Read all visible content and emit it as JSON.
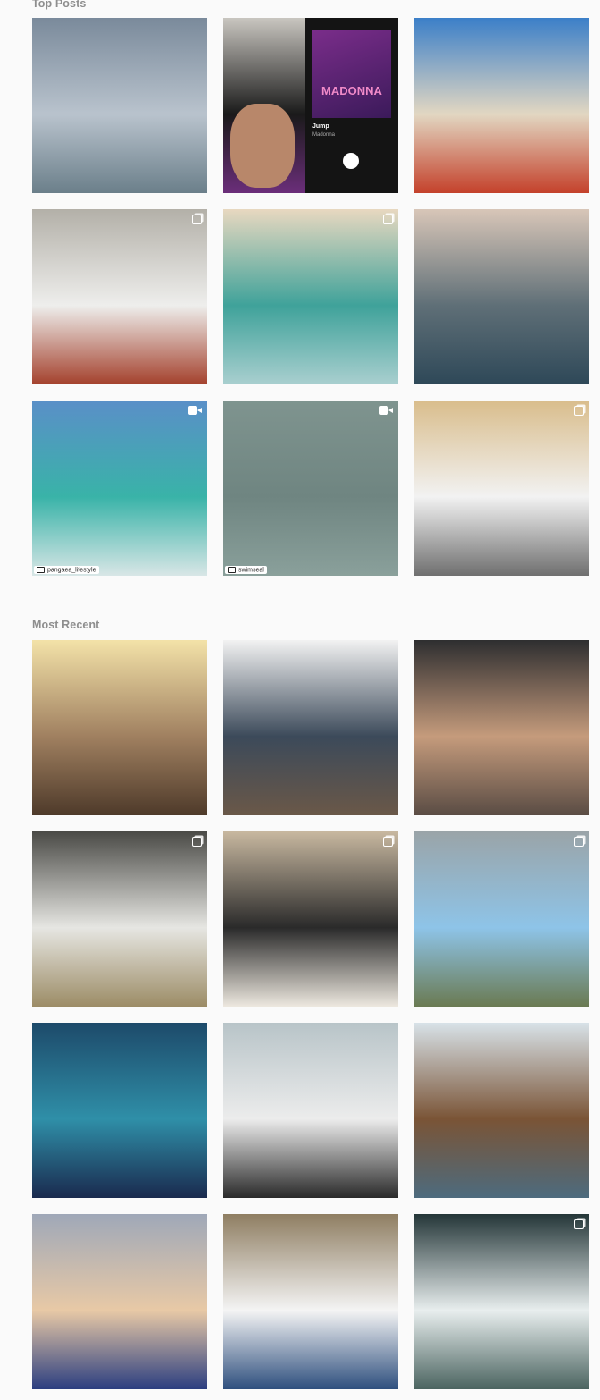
{
  "top_posts": {
    "title": "Top Posts",
    "posts": [
      {
        "name": "post-surfer-small-wave",
        "badge": "none",
        "colors": [
          "#7a8a9b",
          "#b9c3cd",
          "#6b7f8a"
        ]
      },
      {
        "name": "post-selfie-spotify-madonna",
        "badge": "none",
        "colors": [
          "#c9c6c0",
          "#1a1a1a",
          "#6b2e7a"
        ],
        "spotify": {
          "song": "Jump",
          "artist": "Madonna",
          "tag": "MADONNA"
        }
      },
      {
        "name": "post-red-surfboard-beach",
        "badge": "none",
        "colors": [
          "#3b7fc8",
          "#e2d7c2",
          "#c4412b"
        ]
      },
      {
        "name": "post-man-holding-fish-board",
        "badge": "multi",
        "colors": [
          "#b3b0a8",
          "#eeeeec",
          "#a4412d"
        ]
      },
      {
        "name": "post-green-barrel-wave",
        "badge": "video-small",
        "colors": [
          "#e8d8c0",
          "#3fa29a",
          "#a9cfcf"
        ]
      },
      {
        "name": "post-sunset-wave",
        "badge": "none",
        "colors": [
          "#d8c6b8",
          "#5f6f77",
          "#2e4858"
        ]
      },
      {
        "name": "post-turquoise-wave-ride",
        "badge": "video",
        "colors": [
          "#5a8fc8",
          "#39b3a8",
          "#d8e6e6"
        ],
        "repost": "pangaea_lifestyle"
      },
      {
        "name": "post-grey-ocean",
        "badge": "video",
        "colors": [
          "#7f948f",
          "#6f8581",
          "#8aa09b"
        ],
        "repost": "swimseal"
      },
      {
        "name": "post-man-white-surfboard",
        "badge": "multi",
        "colors": [
          "#d9bd8c",
          "#f2f2f2",
          "#6f6f6f"
        ]
      }
    ]
  },
  "most_recent": {
    "title": "Most Recent",
    "posts": [
      {
        "name": "post-golden-sunset-beach",
        "badge": "none",
        "colors": [
          "#f3e2a8",
          "#a08060",
          "#4e3a2a"
        ]
      },
      {
        "name": "post-rocks-coast",
        "badge": "none",
        "colors": [
          "#f2f2f2",
          "#3c4a5a",
          "#6a5848"
        ]
      },
      {
        "name": "post-surprised-face",
        "badge": "none",
        "colors": [
          "#2e2e30",
          "#c59b7c",
          "#5a4c44"
        ]
      },
      {
        "name": "post-surfboard-shaping",
        "badge": "multi",
        "colors": [
          "#4a4a46",
          "#e6e6e2",
          "#9c8c66"
        ]
      },
      {
        "name": "post-cap-signing-board",
        "badge": "multi",
        "colors": [
          "#c8b8a0",
          "#2a2a2a",
          "#ede8df"
        ]
      },
      {
        "name": "post-blue-surfboard-street",
        "badge": "multi",
        "colors": [
          "#9aa4a8",
          "#8ec4e8",
          "#6a7a52"
        ]
      },
      {
        "name": "post-blue-abstract-art",
        "badge": "none",
        "colors": [
          "#1d4a6a",
          "#2f8fa8",
          "#1a2a4e"
        ]
      },
      {
        "name": "post-girl-surfing-lesson",
        "badge": "none",
        "colors": [
          "#b8c4c8",
          "#ececec",
          "#2a2a2a"
        ]
      },
      {
        "name": "post-boards-pier",
        "badge": "none",
        "colors": [
          "#d8e2e8",
          "#7a5436",
          "#4d6b7e"
        ]
      },
      {
        "name": "post-batman-tattoo",
        "badge": "none",
        "colors": [
          "#9fa8b8",
          "#e8c9a6",
          "#2b3e80"
        ]
      },
      {
        "name": "post-white-tshirt-jeans",
        "badge": "none",
        "colors": [
          "#8f7e62",
          "#f4f4f4",
          "#2e4f7e"
        ]
      },
      {
        "name": "post-big-wave-surfer",
        "badge": "multi",
        "colors": [
          "#243638",
          "#e8eeee",
          "#4b6460"
        ]
      }
    ]
  }
}
